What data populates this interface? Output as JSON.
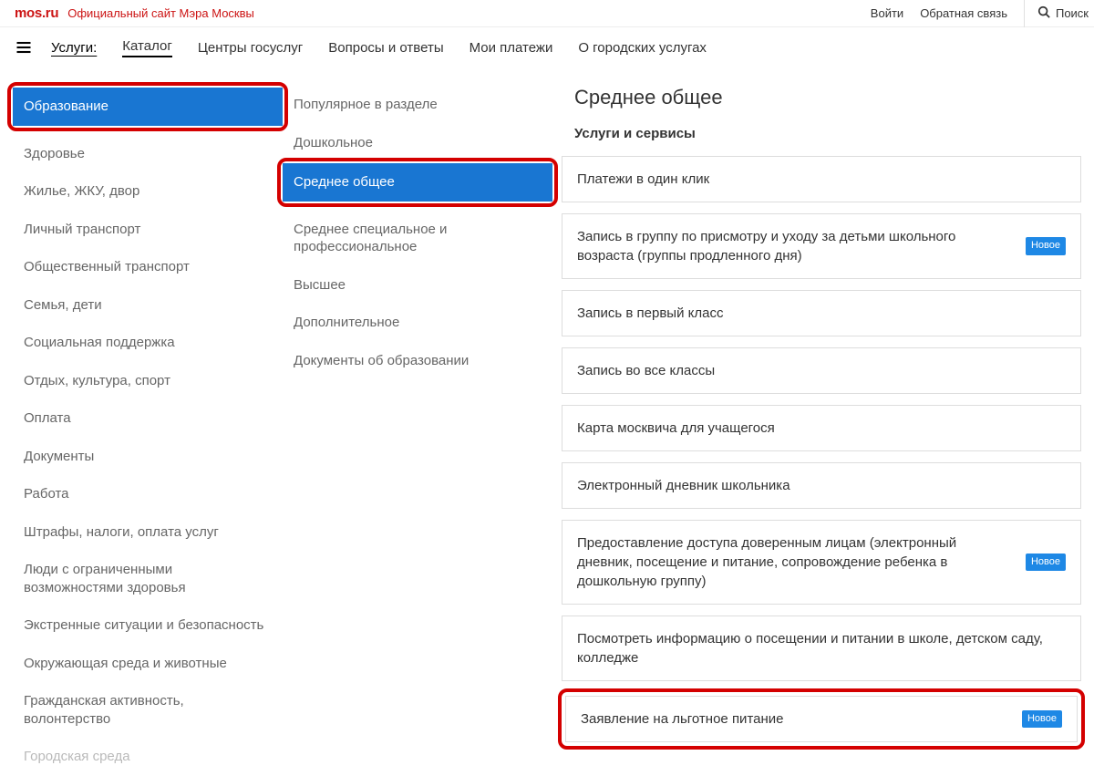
{
  "header": {
    "logo": "mos.ru",
    "subtitle": "Официальный сайт Мэра Москвы",
    "login": "Войти",
    "feedback": "Обратная связь",
    "search": "Поиск"
  },
  "nav": {
    "label": "Услуги:",
    "items": [
      "Каталог",
      "Центры госуслуг",
      "Вопросы и ответы",
      "Мои платежи",
      "О городских услугах"
    ],
    "activeIndex": 0
  },
  "categories": [
    "Образование",
    "Здоровье",
    "Жилье, ЖКУ, двор",
    "Личный транспорт",
    "Общественный транспорт",
    "Семья, дети",
    "Социальная поддержка",
    "Отдых, культура, спорт",
    "Оплата",
    "Документы",
    "Работа",
    "Штрафы, налоги, оплата услуг",
    "Люди с ограниченными возможностями здоровья",
    "Экстренные ситуации и безопасность",
    "Окружающая среда и животные",
    "Гражданская активность, волонтерство",
    "Городская среда"
  ],
  "categoriesActiveIndex": 0,
  "subcategories": [
    "Популярное в разделе",
    "Дошкольное",
    "Среднее общее",
    "Среднее специальное и профессиональное",
    "Высшее",
    "Дополнительное",
    "Документы об образовании"
  ],
  "subcategoriesActiveIndex": 2,
  "main": {
    "title": "Среднее общее",
    "subtitle": "Услуги и сервисы",
    "services": [
      {
        "label": "Платежи в один клик",
        "badge": null
      },
      {
        "label": "Запись в группу по присмотру и уходу за детьми школьного возраста (группы продленного дня)",
        "badge": "Новое"
      },
      {
        "label": "Запись в первый класс",
        "badge": null
      },
      {
        "label": "Запись во все классы",
        "badge": null
      },
      {
        "label": "Карта москвича для учащегося",
        "badge": null
      },
      {
        "label": "Электронный дневник школьника",
        "badge": null
      },
      {
        "label": "Предоставление доступа доверенным лицам (электронный дневник, посещение и питание, сопровождение ребенка в дошкольную группу)",
        "badge": "Новое"
      },
      {
        "label": "Посмотреть информацию о посещении и питании в школе, детском саду, колледже",
        "badge": null
      },
      {
        "label": "Заявление на льготное питание",
        "badge": "Новое"
      }
    ],
    "highlightServiceIndex": 8
  }
}
